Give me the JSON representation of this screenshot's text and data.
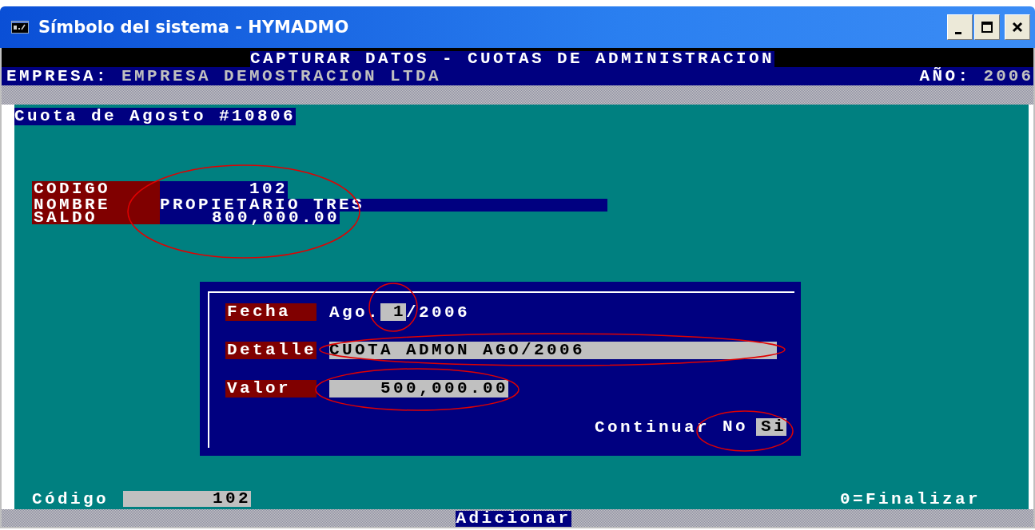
{
  "window": {
    "title": "Símbolo del sistema - HYMADMO"
  },
  "header": {
    "title": "CAPTURAR DATOS - CUOTAS DE ADMINISTRACION",
    "company_label": "EMPRESA:",
    "company": "EMPRESA DEMOSTRACION LTDA",
    "year_label": "AÑO:",
    "year": "2006"
  },
  "section_title": "Cuota de Agosto #10806",
  "record": [
    {
      "label": "CODIGO",
      "value": "102"
    },
    {
      "label": "NOMBRE",
      "value": "PROPIETARIO TRES"
    },
    {
      "label": "SALDO",
      "value": "800,000.00"
    }
  ],
  "dialog": {
    "fecha_label": "Fecha",
    "fecha_month": "Ago.",
    "fecha_day": "1",
    "fecha_year": "/2006",
    "detalle_label": "Detalle",
    "detalle": "CUOTA ADMON AGO/2006",
    "valor_label": "Valor",
    "valor": "500,000.00",
    "continuar_label": "Continuar",
    "options": [
      {
        "label": "No",
        "selected": false
      },
      {
        "label": "Si",
        "selected": true
      }
    ]
  },
  "footer": {
    "code_label": "Código",
    "code": "102",
    "hint": "0=Finalizar",
    "mode": "Adicionar"
  }
}
